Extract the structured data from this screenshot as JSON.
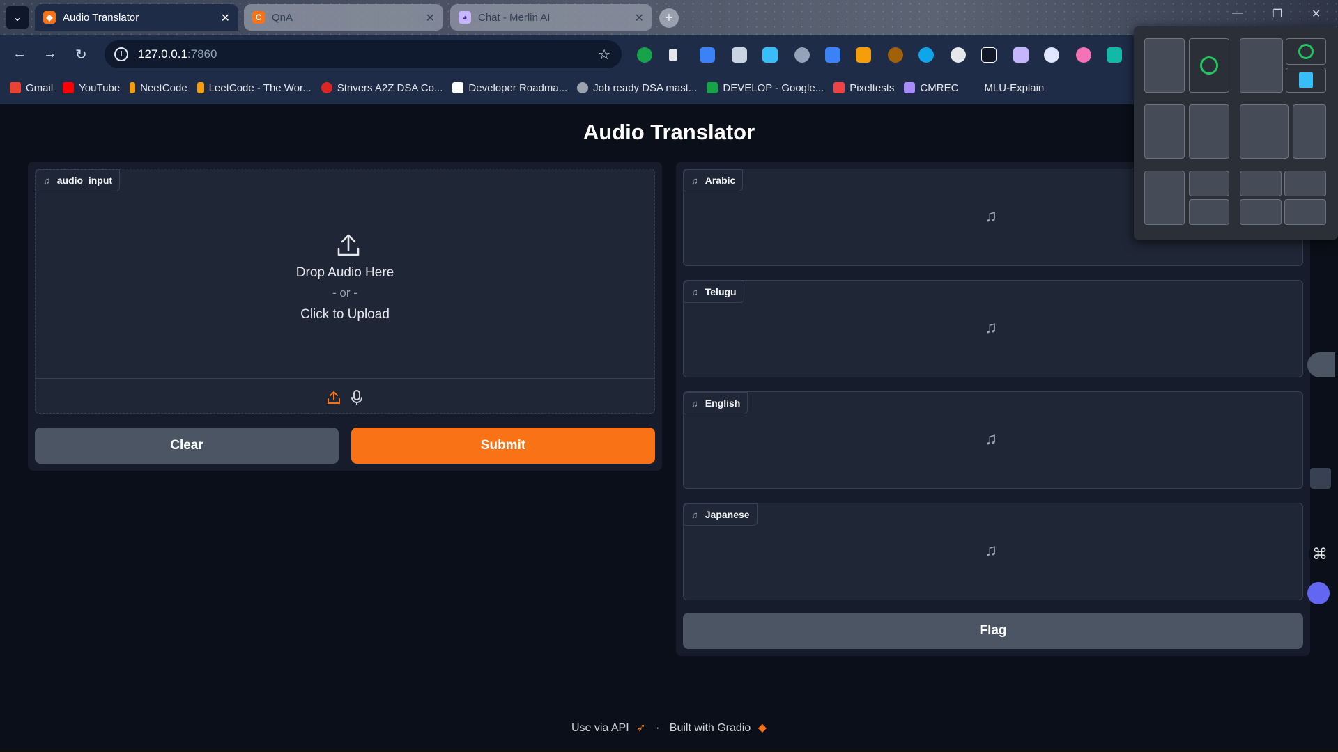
{
  "browser": {
    "tabs": [
      {
        "title": "Audio Translator",
        "active": true
      },
      {
        "title": "QnA",
        "active": false
      },
      {
        "title": "Chat - Merlin AI",
        "active": false
      }
    ],
    "url_host": "127.0.0.1",
    "url_port": ":7860",
    "bookmarks": [
      {
        "label": "Gmail",
        "color": "#ea4335"
      },
      {
        "label": "YouTube",
        "color": "#ff0000"
      },
      {
        "label": "NeetCode",
        "color": "#f59e0b"
      },
      {
        "label": "LeetCode - The Wor...",
        "color": "#f59e0b"
      },
      {
        "label": "Strivers A2Z DSA Co...",
        "color": "#dc2626"
      },
      {
        "label": "Developer Roadma...",
        "color": "#ffffff"
      },
      {
        "label": "Job ready DSA mast...",
        "color": "#9ca3af"
      },
      {
        "label": "DEVELOP - Google...",
        "color": "#16a34a"
      },
      {
        "label": "Pixeltests",
        "color": "#ef4444"
      },
      {
        "label": "CMREC",
        "color": "#a78bfa"
      },
      {
        "label": "MLU-Explain",
        "color": "#1f2c47"
      }
    ]
  },
  "app": {
    "title": "Audio Translator",
    "input_label": "audio_input",
    "drop_text": "Drop Audio Here",
    "or_text": "- or -",
    "click_text": "Click to Upload",
    "clear_label": "Clear",
    "submit_label": "Submit",
    "outputs": [
      {
        "label": "Arabic"
      },
      {
        "label": "Telugu"
      },
      {
        "label": "English"
      },
      {
        "label": "Japanese"
      }
    ],
    "flag_label": "Flag",
    "footer_api": "Use via API",
    "footer_sep": "·",
    "footer_built": "Built with Gradio"
  },
  "colors": {
    "accent": "#f97316",
    "background": "#0b0f19"
  }
}
